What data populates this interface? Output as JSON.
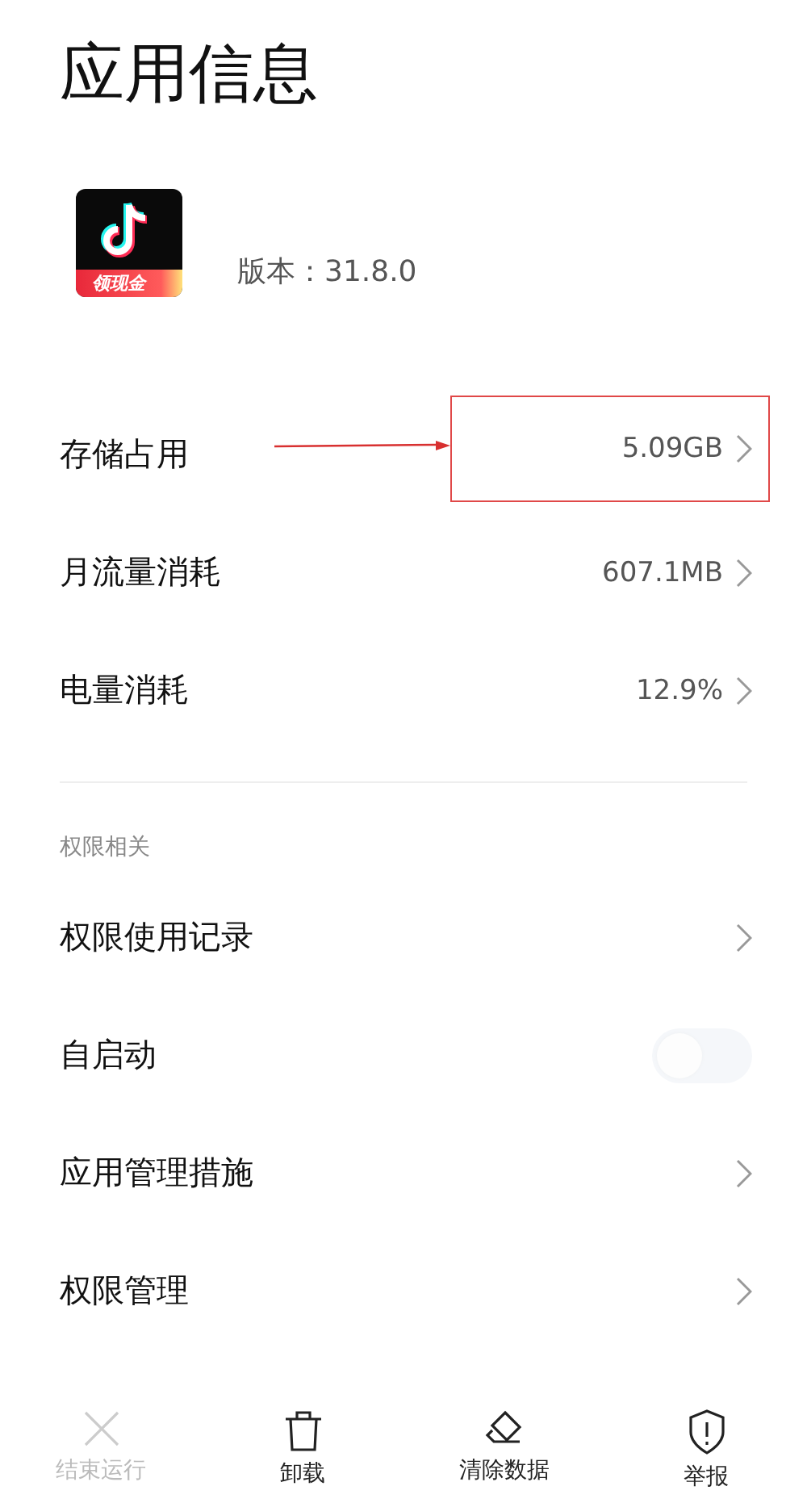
{
  "title": "应用信息",
  "app": {
    "badge": "领现金",
    "version": "版本：31.8.0"
  },
  "rows": [
    {
      "kind": "link",
      "label": "存储占用",
      "value": "5.09GB",
      "highlighted": true
    },
    {
      "kind": "link",
      "label": "月流量消耗",
      "value": "607.1MB",
      "highlighted": false
    },
    {
      "kind": "link",
      "label": "电量消耗",
      "value": "12.9%",
      "highlighted": false
    }
  ],
  "section": {
    "title": "权限相关",
    "rows": [
      {
        "kind": "link",
        "label": "权限使用记录"
      },
      {
        "kind": "toggle",
        "label": "自启动",
        "on": false
      },
      {
        "kind": "link",
        "label": "应用管理措施"
      },
      {
        "kind": "link",
        "label": "权限管理"
      }
    ]
  },
  "actions": [
    {
      "kind": "close",
      "label": "结束运行",
      "disabled": true
    },
    {
      "kind": "trash",
      "label": "卸载",
      "disabled": false
    },
    {
      "kind": "eraser",
      "label": "清除数据",
      "disabled": false
    },
    {
      "kind": "report",
      "label": "举报",
      "disabled": false
    }
  ]
}
